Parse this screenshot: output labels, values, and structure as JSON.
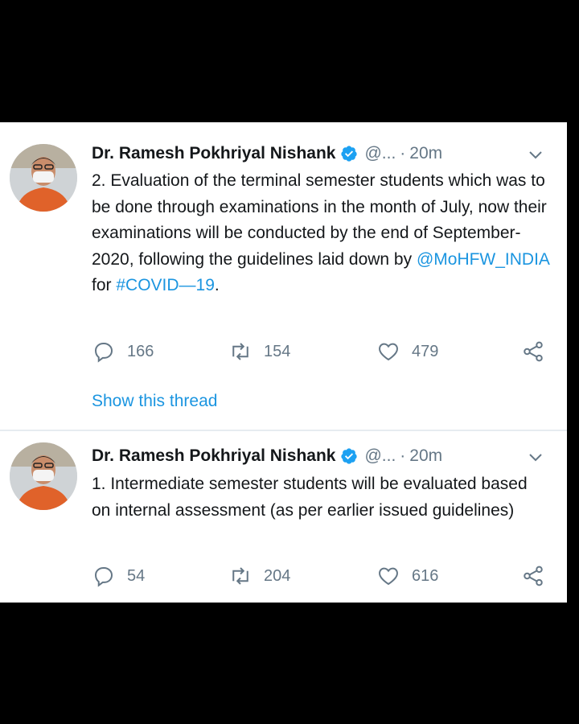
{
  "tweets": [
    {
      "author_name": "Dr. Ramesh Pokhriyal Nishank",
      "handle": "@...",
      "dot": "·",
      "time": "20m",
      "text_main": "2. Evaluation of the terminal semester students which was to be done through examinations in the month of July, now their examinations will be conducted by the end of September-2020, following the guidelines laid down by",
      "mention": "@MoHFW_INDIA",
      "text_for": " for ",
      "hashtag": "#COVID—19",
      "text_end": ".",
      "replies": "166",
      "retweets": "154",
      "likes": "479",
      "thread_link": "Show this thread"
    },
    {
      "author_name": "Dr. Ramesh Pokhriyal Nishank",
      "handle": "@...",
      "dot": "·",
      "time": "20m",
      "text_main": "1. Intermediate semester students will be evaluated based on internal assessment (as per earlier issued guidelines)",
      "replies": "54",
      "retweets": "204",
      "likes": "616"
    }
  ],
  "colors": {
    "link": "#1b95e0",
    "verified": "#1da1f2",
    "muted": "#657786",
    "text": "#14171a"
  },
  "icons": [
    "verified-badge-icon",
    "chevron-down-icon",
    "reply-icon",
    "retweet-icon",
    "like-icon",
    "share-icon"
  ]
}
